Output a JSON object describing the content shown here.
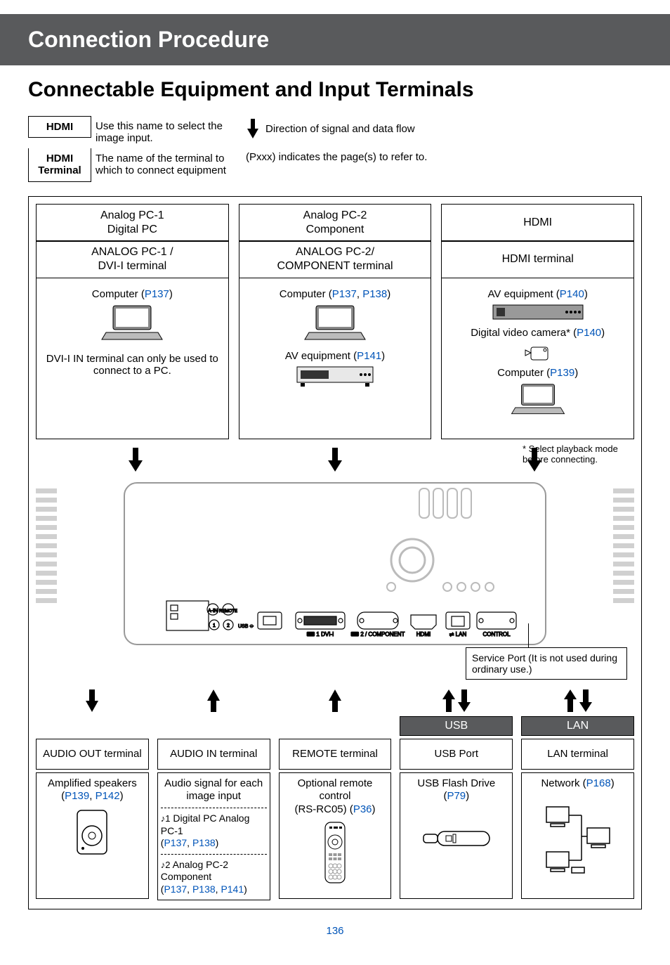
{
  "page_number": "136",
  "header": "Connection Procedure",
  "section_title": "Connectable Equipment and Input Terminals",
  "legend": {
    "box1": "HDMI",
    "text1": "Use this name to select the image input.",
    "box2_l1": "HDMI",
    "box2_l2": "Terminal",
    "text2": "The name of the terminal to which to connect equipment",
    "right1": "Direction of signal and data flow",
    "right2": "(Pxxx) indicates the page(s) to refer to."
  },
  "top_columns": [
    {
      "title_l1": "Analog PC-1",
      "title_l2": "Digital PC",
      "term_l1": "ANALOG PC-1 /",
      "term_l2": "DVI-I terminal",
      "equip_l1": "Computer (",
      "equip_p1": "P137",
      "equip_l1b": ")",
      "note_l1": "DVI-I IN terminal can only be used to connect to a PC."
    },
    {
      "title_l1": "Analog PC-2",
      "title_l2": "Component",
      "term_l1": "ANALOG PC-2/",
      "term_l2": "COMPONENT terminal",
      "equip_l1": "Computer (",
      "equip_p1": "P137",
      "equip_comma": ", ",
      "equip_p2": "P138",
      "equip_l1b": ")",
      "equip_l2": "AV equipment (",
      "equip_p3": "P141",
      "equip_l2b": ")"
    },
    {
      "title_l1": "HDMI",
      "term_l1": "HDMI terminal",
      "equip_l1": "AV equipment (",
      "equip_p1": "P140",
      "equip_l1b": ")",
      "equip_l2": "Digital video camera* (",
      "equip_p2": "P140",
      "equip_l2b": ")",
      "equip_l3": "Computer (",
      "equip_p3": "P139",
      "equip_l3b": ")"
    }
  ],
  "playback_note": "* Select playback mode before connecting.",
  "service_note": "Service Port (It is not used during ordinary use.)",
  "bottom_columns": [
    {
      "header": "",
      "term": "AUDIO OUT terminal",
      "body_l1": "Amplified speakers",
      "body_open": "(",
      "p1": "P139",
      "comma": ", ",
      "p2": "P142",
      "body_close": ")"
    },
    {
      "header": "",
      "term": "AUDIO IN terminal",
      "body_l1": "Audio signal for each image input",
      "sub1_pre": " Digital PC Analog PC-1",
      "sub1_open": "(",
      "sub1_p1": "P137",
      "sub1_comma": ", ",
      "sub1_p2": "P138",
      "sub1_close": ")",
      "sub2_pre": " Analog PC-2 Component",
      "sub2_open": "(",
      "sub2_p1": "P137",
      "sub2_comma1": ", ",
      "sub2_p2": "P138",
      "sub2_comma2": ", ",
      "sub2_p3": "P141",
      "sub2_close": ")"
    },
    {
      "header": "",
      "term": "REMOTE terminal",
      "body_l1": "Optional remote control",
      "body_l2_pre": "(RS-RC05) (",
      "p1": "P36",
      "body_l2_post": ")"
    },
    {
      "header": "USB",
      "term": "USB Port",
      "body_l1": "USB Flash Drive",
      "body_open": "(",
      "p1": "P79",
      "body_close": ")"
    },
    {
      "header": "LAN",
      "term": "LAN terminal",
      "body_l1": "Network (",
      "p1": "P168",
      "body_close": ")"
    }
  ],
  "music_labels": {
    "m1": "♪1",
    "m2": "♪2"
  }
}
